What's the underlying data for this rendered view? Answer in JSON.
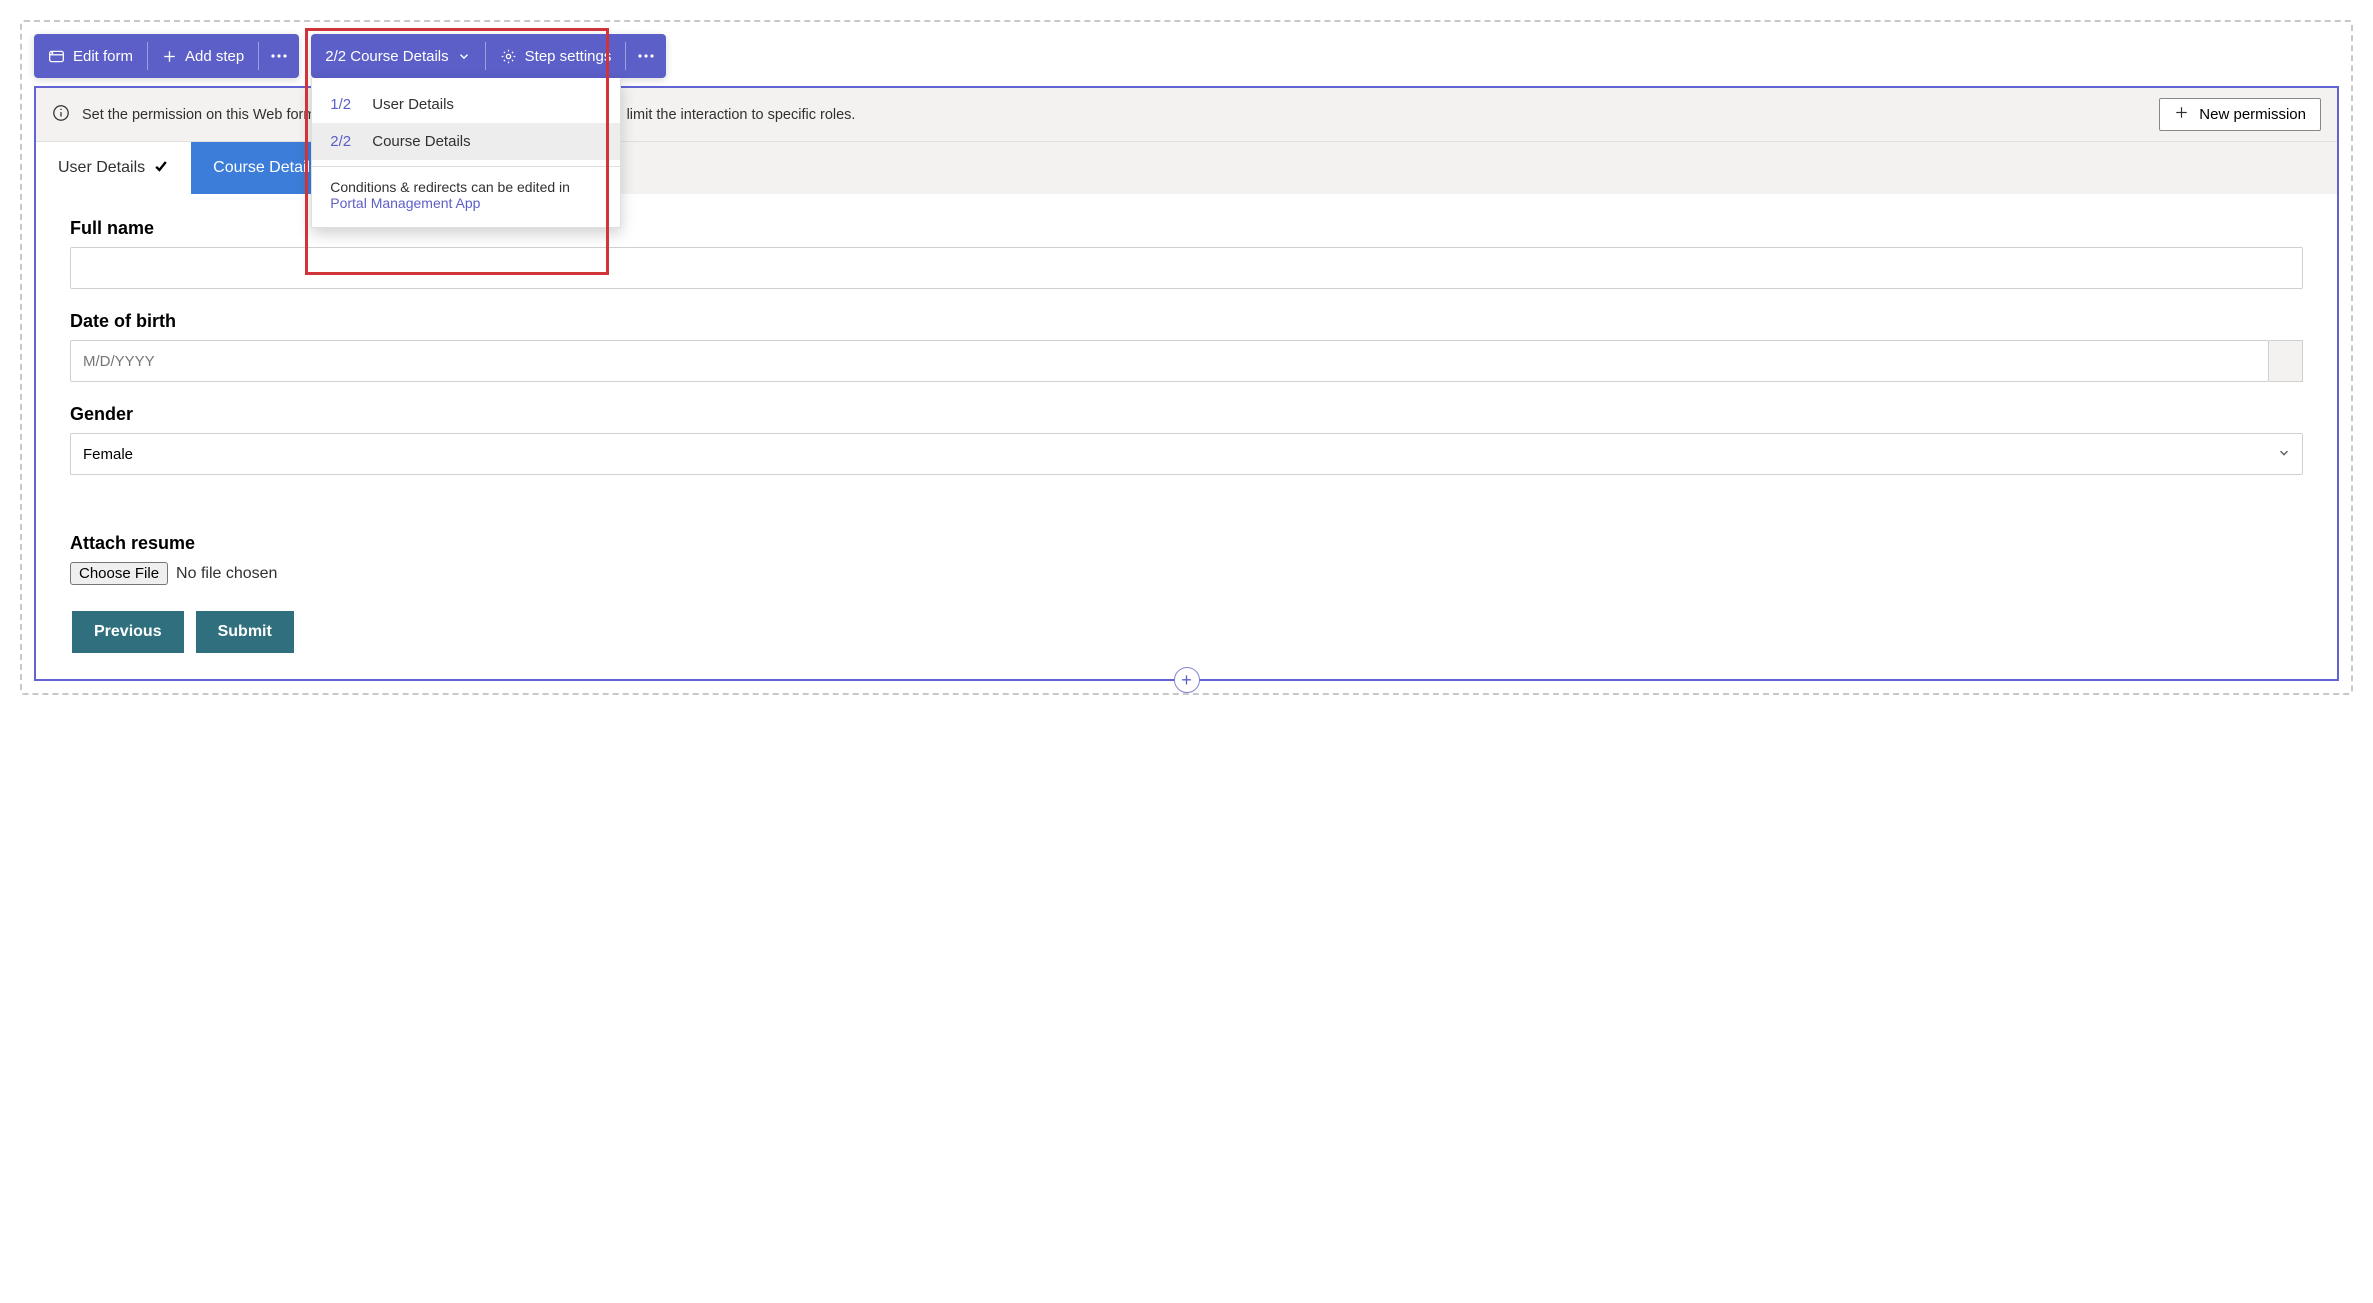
{
  "toolbar": {
    "edit_form": "Edit form",
    "add_step": "Add step",
    "step_selector": "2/2 Course Details",
    "step_settings": "Step settings"
  },
  "dropdown": {
    "items": [
      {
        "num": "1/2",
        "label": "User Details",
        "selected": false
      },
      {
        "num": "2/2",
        "label": "Course Details",
        "selected": true
      }
    ],
    "footer_text": "Conditions & redirects can be edited in",
    "footer_link": "Portal Management App"
  },
  "notification": {
    "text_pre": "Set the permission on this Web form so it ca",
    "text_post": " limit the interaction to specific roles.",
    "new_permission": "New permission"
  },
  "tabs": [
    {
      "label": "User Details",
      "state": "completed"
    },
    {
      "label": "Course Details",
      "state": "active"
    }
  ],
  "form": {
    "full_name": {
      "label": "Full name",
      "value": ""
    },
    "dob": {
      "label": "Date of birth",
      "placeholder": "M/D/YYYY",
      "value": ""
    },
    "gender": {
      "label": "Gender",
      "value": "Female"
    },
    "attach": {
      "label": "Attach resume",
      "button": "Choose File",
      "status": "No file chosen"
    }
  },
  "actions": {
    "previous": "Previous",
    "submit": "Submit"
  }
}
